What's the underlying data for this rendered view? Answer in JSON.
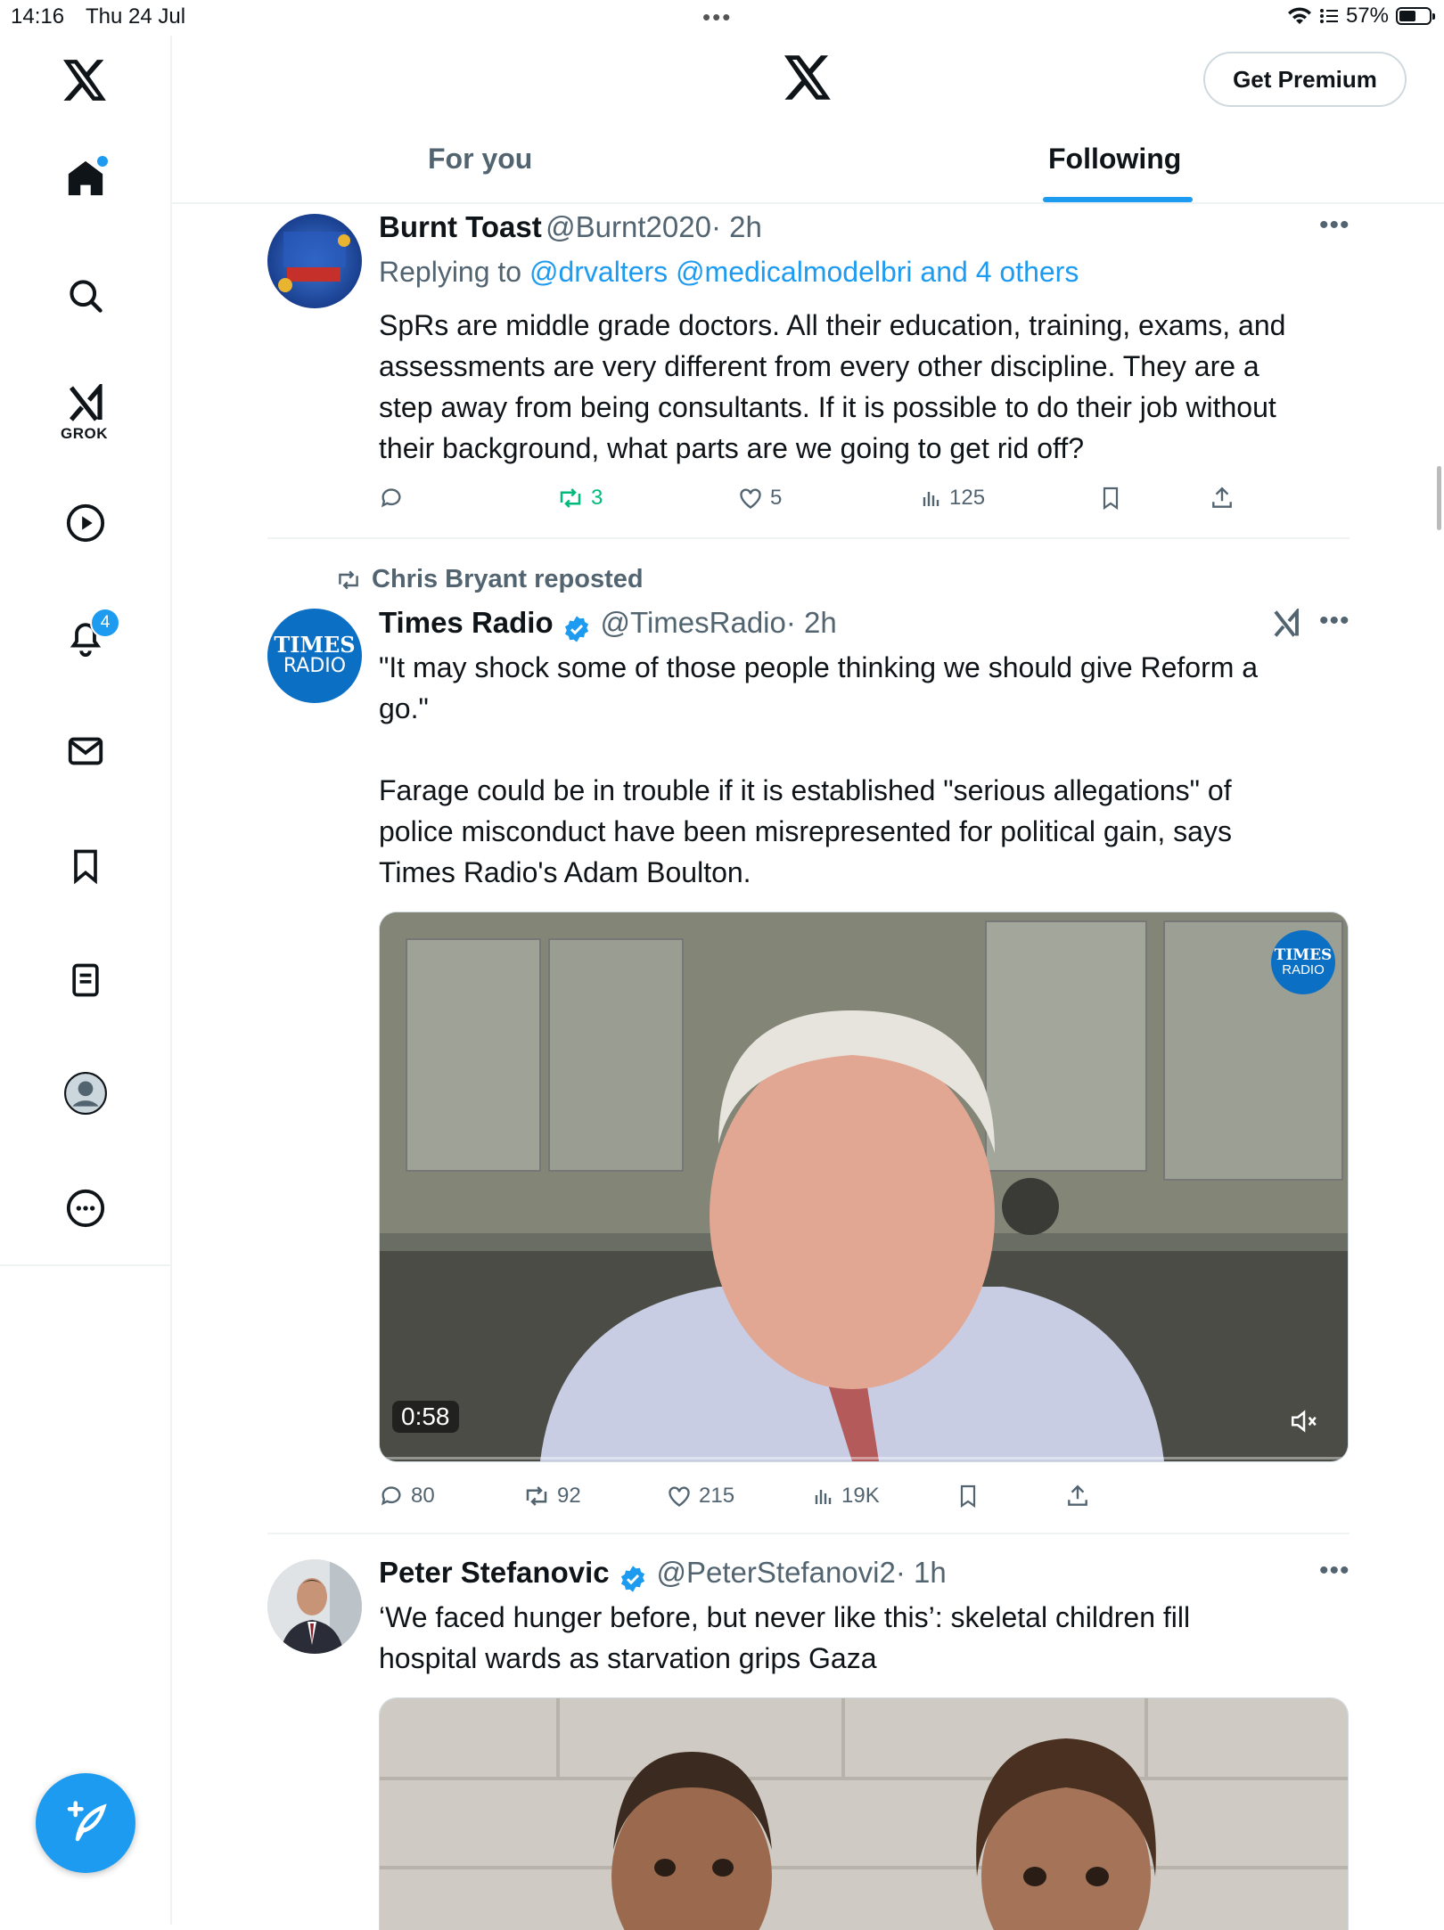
{
  "status": {
    "time": "14:16",
    "date": "Thu 24 Jul",
    "battery": "57%",
    "battery_level": 0.57
  },
  "header": {
    "premium_label": "Get Premium"
  },
  "tabs": [
    {
      "label": "For you",
      "active": false
    },
    {
      "label": "Following",
      "active": true
    }
  ],
  "sidebar": {
    "items": [
      "x-logo",
      "home",
      "search",
      "grok",
      "video",
      "notifications",
      "messages",
      "bookmarks",
      "lists",
      "profile",
      "more"
    ],
    "grok_label": "GROK",
    "notification_count": "4"
  },
  "tweets": [
    {
      "name": "Burnt Toast",
      "handle": "@Burnt2020",
      "time": "· 2h",
      "reply_prefix": "Replying to",
      "reply_targets": "@drvalters @medicalmodelbri and 4 others",
      "lines": [
        "SpRs are middle grade doctors. All their education, training, exams, and",
        "assessments are very different from every other discipline. They are a",
        "step away from being consultants. If it is possible to do their job without",
        "their background, what parts are we going to get rid off?"
      ],
      "replies": "",
      "reposts": "3",
      "likes": "5",
      "views": "125"
    },
    {
      "repost_by": "Chris Bryant reposted",
      "name": "Times Radio",
      "handle": "@TimesRadio",
      "time": "· 2h",
      "lines": [
        "\"It may shock some of those people thinking we should give Reform a",
        "go.\"",
        "",
        "Farage could be in trouble if it is established \"serious allegations\" of",
        "police misconduct have been misrepresented for political gain, says",
        "Times Radio's Adam Boulton."
      ],
      "video_duration": "0:58",
      "logo_text_1": "TIMES",
      "logo_text_2": "RADIO",
      "replies": "80",
      "reposts": "92",
      "likes": "215",
      "views": "19K"
    },
    {
      "name": "Peter Stefanovic",
      "handle": "@PeterStefanovi2",
      "time": "· 1h",
      "lines": [
        "‘We faced hunger before, but never like this’: skeletal children fill",
        "hospital wards as starvation grips Gaza"
      ]
    }
  ],
  "colors": {
    "accent": "#1d9bf0",
    "repost_green": "#00ba7c",
    "muted": "#536471",
    "times_blue": "#0b6fc4"
  }
}
